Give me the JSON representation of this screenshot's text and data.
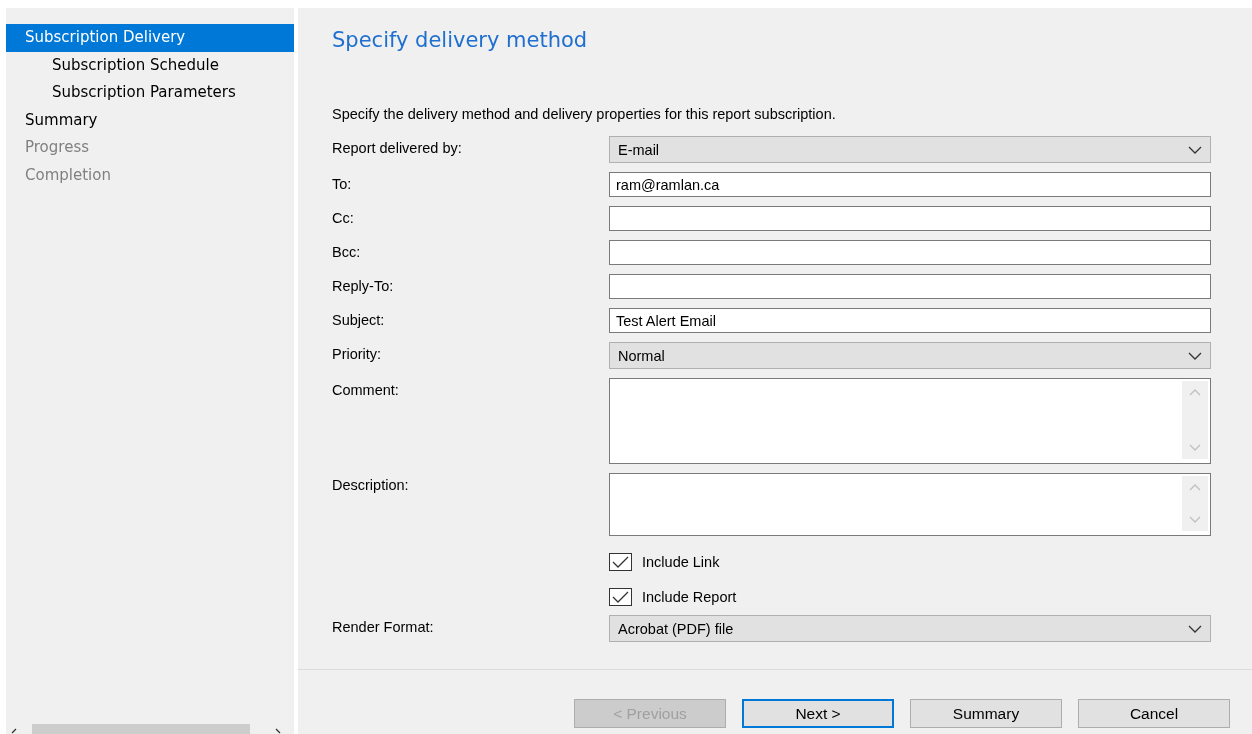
{
  "sidebar": {
    "items": [
      {
        "label": "Subscription Delivery",
        "selected": true,
        "disabled": false,
        "children": [
          {
            "label": "Subscription Schedule",
            "selected": false,
            "disabled": false
          },
          {
            "label": "Subscription Parameters",
            "selected": false,
            "disabled": false
          }
        ]
      },
      {
        "label": "Summary",
        "selected": false,
        "disabled": false
      },
      {
        "label": "Progress",
        "selected": false,
        "disabled": true
      },
      {
        "label": "Completion",
        "selected": false,
        "disabled": true
      }
    ]
  },
  "page": {
    "title": "Specify delivery method",
    "intro": "Specify the delivery method and delivery properties for this report subscription.",
    "fields": [
      {
        "kind": "select",
        "label": "Report delivered by:",
        "value": "E-mail"
      },
      {
        "kind": "text",
        "label": "To:",
        "value": "ram@ramlan.ca"
      },
      {
        "kind": "text",
        "label": "Cc:"
      },
      {
        "kind": "text",
        "label": "Bcc:"
      },
      {
        "kind": "text",
        "label": "Reply-To:"
      },
      {
        "kind": "text",
        "label": "Subject:",
        "value": "Test Alert Email"
      },
      {
        "kind": "select",
        "label": "Priority:",
        "value": "Normal"
      },
      {
        "kind": "textarea",
        "label": "Comment:"
      },
      {
        "kind": "shorttextarea",
        "label": "Description:"
      },
      {
        "kind": "checkbox",
        "label": "Include Link",
        "checked": true
      },
      {
        "kind": "checkbox",
        "label": "Include Report",
        "checked": true
      },
      {
        "kind": "select",
        "label": "Render Format:",
        "value": "Acrobat (PDF) file"
      }
    ]
  },
  "buttons": [
    {
      "label": "< Previous",
      "disabled": true,
      "default": false
    },
    {
      "label": "Next >",
      "disabled": false,
      "default": true
    },
    {
      "label": "Summary",
      "disabled": false,
      "default": false
    },
    {
      "label": "Cancel",
      "disabled": false,
      "default": false
    }
  ]
}
